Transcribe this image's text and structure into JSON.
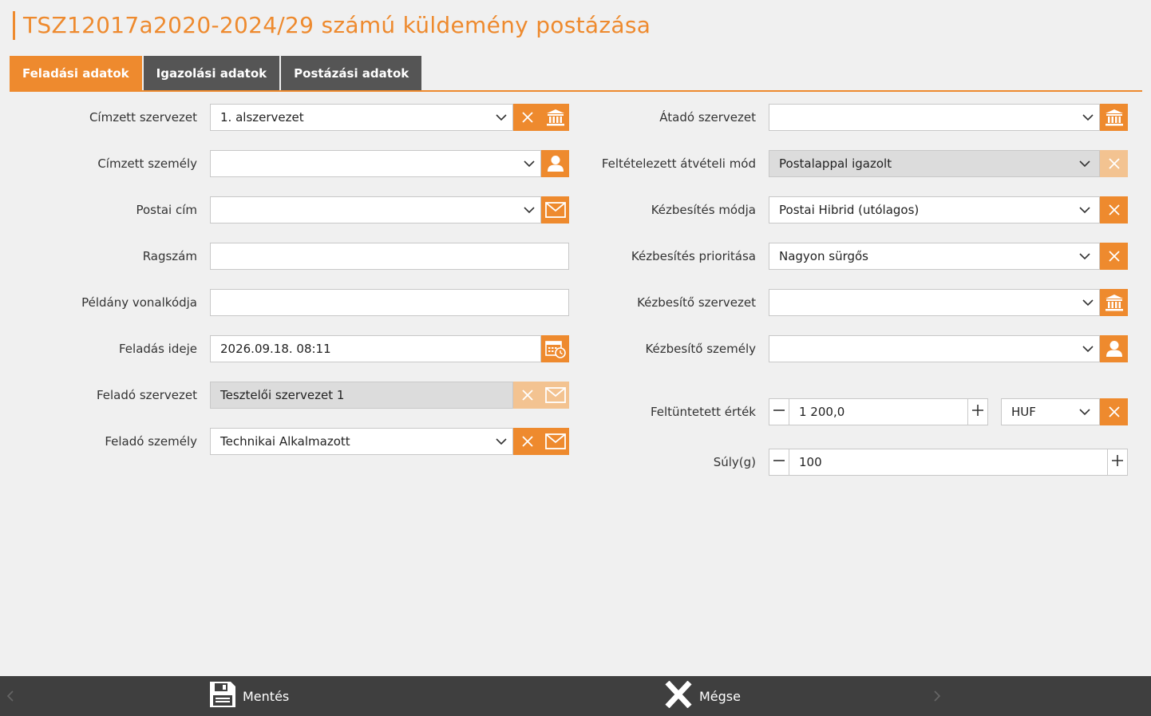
{
  "title": "TSZ12017a2020-2024/29 számú küldemény postázása",
  "tabs": [
    {
      "label": "Feladási adatok"
    },
    {
      "label": "Igazolási adatok"
    },
    {
      "label": "Postázási adatok"
    }
  ],
  "left": {
    "cimzett_szervezet": {
      "label": "Címzett szervezet",
      "value": "1. alszervezet"
    },
    "cimzett_szemely": {
      "label": "Címzett személy",
      "value": ""
    },
    "postai_cim": {
      "label": "Postai cím",
      "value": ""
    },
    "ragszam": {
      "label": "Ragszám",
      "value": ""
    },
    "peldany_vonalkodja": {
      "label": "Példány vonalkódja",
      "value": ""
    },
    "feladas_ideje": {
      "label": "Feladás ideje",
      "value": "2026.09.18. 08:11"
    },
    "felado_szervezet": {
      "label": "Feladó szervezet",
      "value": "Tesztelői szervezet 1"
    },
    "felado_szemely": {
      "label": "Feladó személy",
      "value": "Technikai Alkalmazott"
    }
  },
  "right": {
    "atado_szervezet": {
      "label": "Átadó szervezet",
      "value": ""
    },
    "atveteli_mod": {
      "label": "Feltételezett átvételi mód",
      "value": "Postalappal igazolt"
    },
    "kezbesites_modja": {
      "label": "Kézbesítés módja",
      "value": "Postai Hibrid (utólagos)"
    },
    "kezbesites_prioritasa": {
      "label": "Kézbesítés prioritása",
      "value": "Nagyon sürgős"
    },
    "kezbesito_szervezet": {
      "label": "Kézbesítő szervezet",
      "value": ""
    },
    "kezbesito_szemely": {
      "label": "Kézbesítő személy",
      "value": ""
    },
    "feltuntetett_ertek": {
      "label": "Feltüntetett érték",
      "value": "1 200,0",
      "currency": "HUF"
    },
    "suly": {
      "label": "Súly(g)",
      "value": "100"
    }
  },
  "footer": {
    "save_label": "Mentés",
    "cancel_label": "Mégse"
  },
  "colors": {
    "accent": "#ee8a2e",
    "tab_inactive": "#555555",
    "footer_bg": "#3f3f3f"
  }
}
